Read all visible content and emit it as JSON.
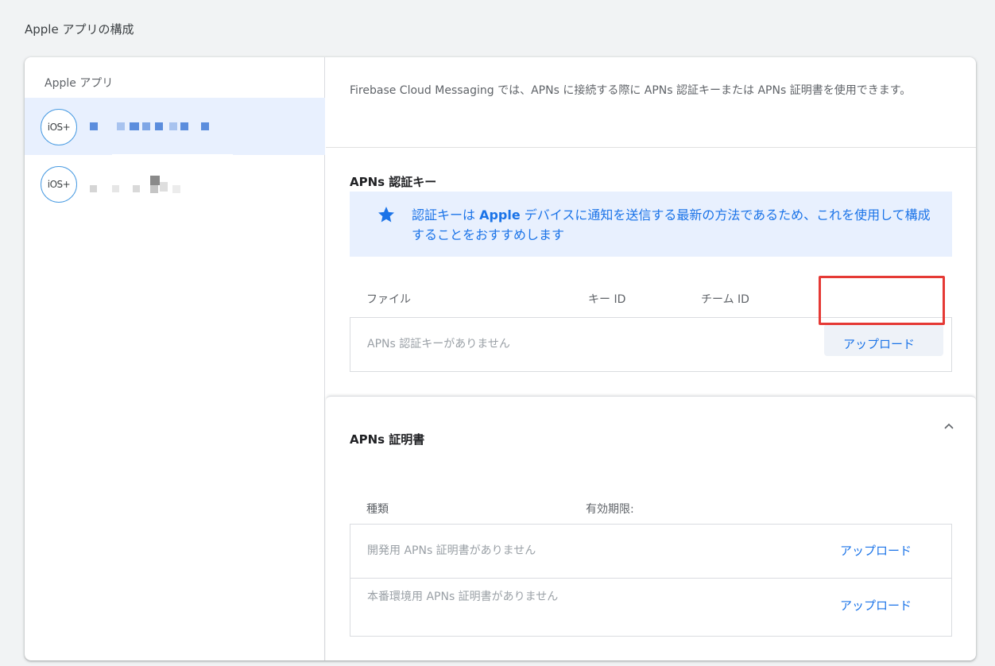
{
  "page": {
    "title": "Apple アプリの構成"
  },
  "sidebar": {
    "heading": "Apple アプリ",
    "apps": [
      {
        "badge": "iOS+",
        "selected": true
      },
      {
        "badge": "iOS+",
        "selected": false
      }
    ]
  },
  "main": {
    "intro": "Firebase Cloud Messaging では、APNs に接続する際に APNs 認証キーまたは APNs 証明書を使用できます。",
    "auth_key": {
      "title": "APNs 認証キー",
      "callout_prefix": "認証キーは ",
      "callout_bold": "Apple",
      "callout_suffix": " デバイスに通知を送信する最新の方法であるため、これを使用して構成することをおすすめします",
      "columns": [
        "ファイル",
        "キー ID",
        "チーム ID"
      ],
      "empty": "APNs 認証キーがありません",
      "upload_label": "アップロード"
    },
    "certificates": {
      "title": "APNs 証明書",
      "columns": [
        "種類",
        "有効期限:"
      ],
      "rows": [
        {
          "text": "開発用 APNs 証明書がありません",
          "upload_label": "アップロード"
        },
        {
          "text": "本番環境用 APNs 証明書がありません",
          "upload_label": "アップロード"
        }
      ]
    }
  },
  "colors": {
    "accent": "#1a73e8",
    "highlight": "#e53935",
    "selected_bg": "#e8f0fe"
  }
}
